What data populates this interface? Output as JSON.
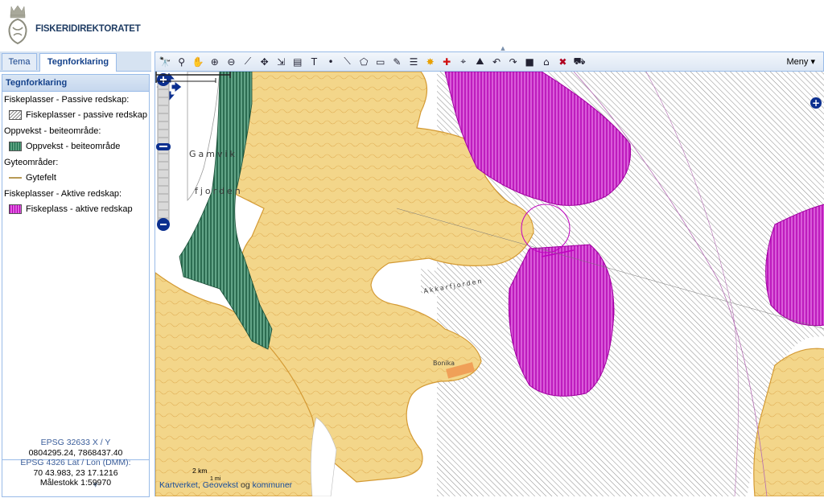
{
  "header": {
    "brand": "FISKERIDIREKTORATET",
    "logo_icon": "crown-emblem-icon"
  },
  "left_panel": {
    "tabs": [
      {
        "label": "Tema",
        "active": false
      },
      {
        "label": "Tegnforklaring",
        "active": true
      }
    ],
    "legend": {
      "title": "Tegnforklaring",
      "groups": [
        {
          "heading": "Fiskeplasser - Passive redskap:",
          "item": "Fiskeplasser - passive redskap",
          "color": "#888888"
        },
        {
          "heading": "Oppvekst - beiteområde:",
          "item": "Oppvekst - beiteområde",
          "color": "#1d6f4f"
        },
        {
          "heading": "Gyteområder:",
          "item": "Gytefelt",
          "color": "#b89a55"
        },
        {
          "heading": "Fiskeplasser - Aktive redskap:",
          "item": "Fiskeplass - aktive redskap",
          "color": "#b400b4"
        }
      ]
    },
    "coords": {
      "epsg32633_label": "EPSG 32633 X / Y",
      "epsg32633_value": "0804295.24, 7868437.40",
      "epsg4326_label": "EPSG 4326 Lat / Lon (DMM):",
      "epsg4326_value": "70 43.983, 23 17.1216",
      "scale": "Målestokk 1:59970"
    }
  },
  "toolbar": {
    "menu_label": "Meny ▾",
    "tools": [
      "binoculars-icon",
      "binoculars-search-icon",
      "pan-hand-icon",
      "zoom-in-icon",
      "zoom-out-icon",
      "measure-line-icon",
      "pan-arrows-icon",
      "export-icon",
      "print-icon",
      "text-icon",
      "point-icon",
      "line-icon",
      "polygon-icon",
      "rectangle-icon",
      "edit-icon",
      "list-icon",
      "highlight-icon",
      "add-red-cross-icon",
      "utm-icon",
      "terrain-icon",
      "undo-icon",
      "redo-icon",
      "stop-icon",
      "gps-icon",
      "clear-icon",
      "vehicle-icon"
    ]
  },
  "map": {
    "place_labels": [
      "Gamvik",
      "fjorden",
      "Akkarfjorden",
      "Bonika"
    ],
    "scale_km": "2 km",
    "scale_mi": "1 mi",
    "attribution": {
      "part1": "Kartverket",
      "sep": ", ",
      "part2": "Geovekst",
      "and": " og ",
      "part3": "kommuner"
    },
    "colors": {
      "land": "#f3d68a",
      "sea": "#ffffff",
      "passive": "#8a8a8a",
      "oppvekst": "#1d6f4f",
      "aktiv": "#c21cc2",
      "nav": "#0b2f8f"
    }
  }
}
